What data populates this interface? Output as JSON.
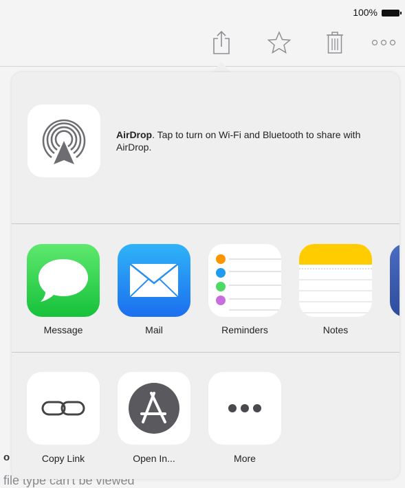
{
  "status": {
    "battery_percent": "100%"
  },
  "toolbar": {
    "buttons": [
      "share-icon",
      "star-icon",
      "trash-icon",
      "more-dots-icon"
    ]
  },
  "background": {
    "heading_fragment": "o",
    "message": "file type can't be viewed"
  },
  "airdrop": {
    "title": "AirDrop",
    "description": ". Tap to turn on Wi-Fi and Bluetooth to share with AirDrop."
  },
  "share_apps": [
    {
      "label": "Message",
      "icon": "message-icon"
    },
    {
      "label": "Mail",
      "icon": "mail-icon"
    },
    {
      "label": "Reminders",
      "icon": "reminders-icon"
    },
    {
      "label": "Notes",
      "icon": "notes-icon"
    }
  ],
  "actions": [
    {
      "label": "Copy Link",
      "icon": "link-icon"
    },
    {
      "label": "Open In...",
      "icon": "app-store-icon"
    },
    {
      "label": "More",
      "icon": "more-icon"
    }
  ],
  "colors": {
    "sheet_bg": "#efeff0",
    "message_green": "#16c13a",
    "mail_blue": "#1c6fef",
    "notes_yellow": "#ffcc00",
    "open_in_gray": "#5a5a5e"
  }
}
